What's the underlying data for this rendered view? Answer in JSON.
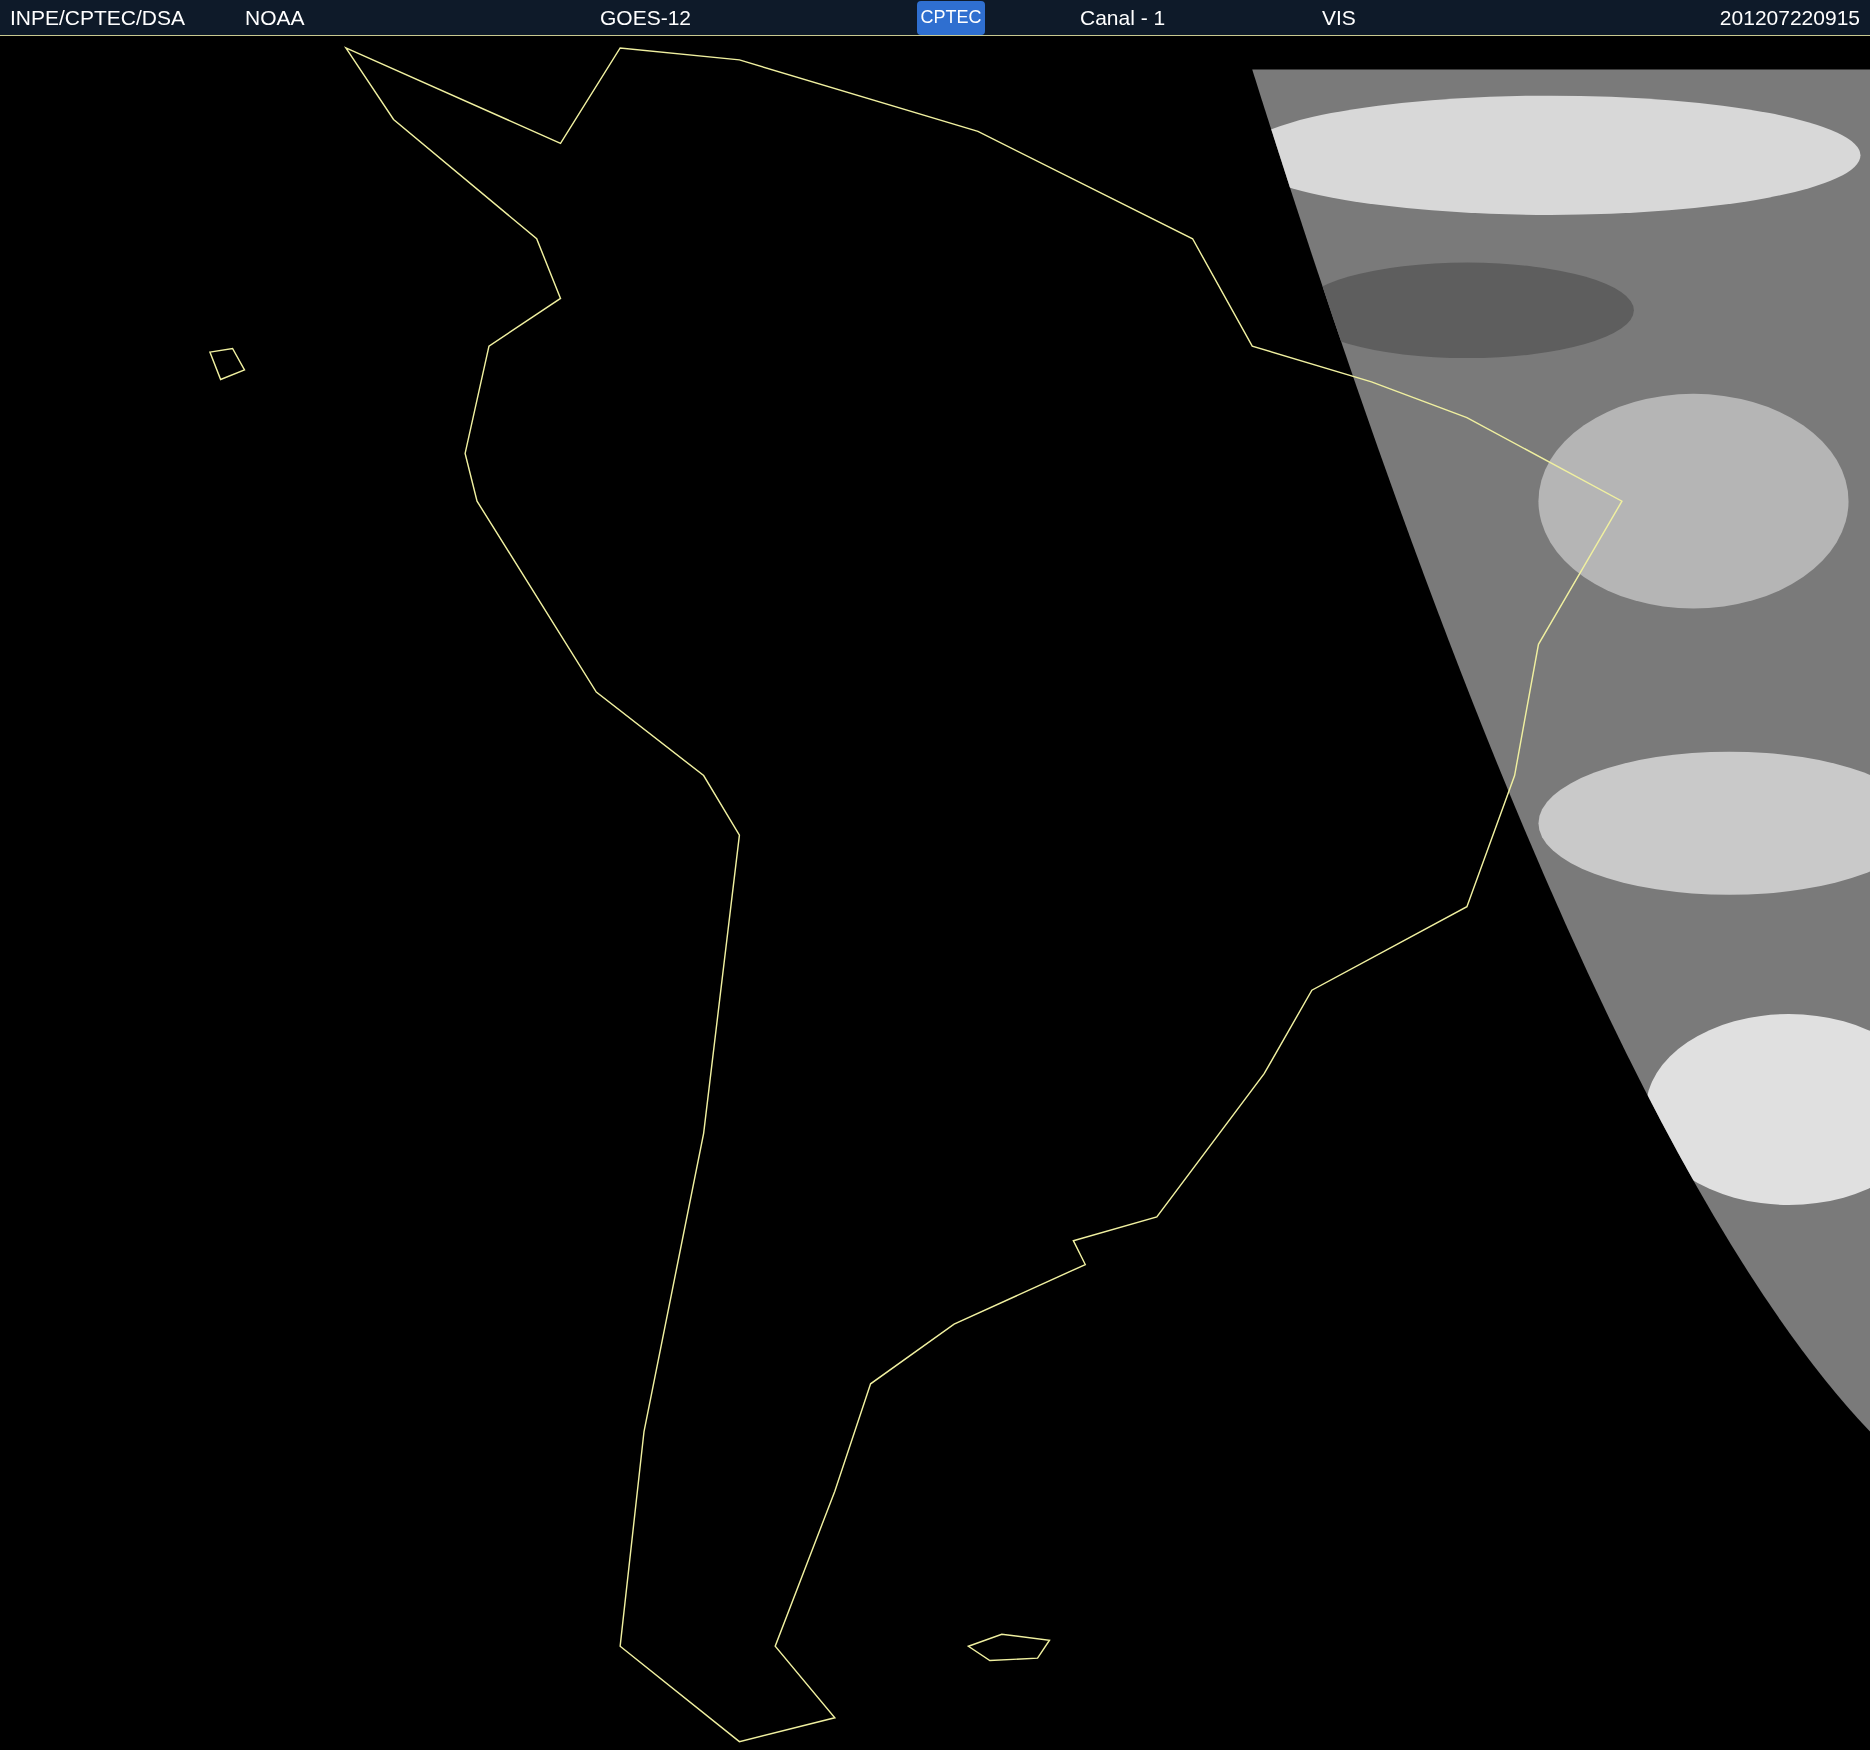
{
  "header": {
    "source": "INPE/CPTEC/DSA",
    "agency": "NOAA",
    "satellite": "GOES-12",
    "logo": "CPTEC",
    "channel": "Canal - 1",
    "band": "VIS",
    "timestamp": "201207220915"
  }
}
